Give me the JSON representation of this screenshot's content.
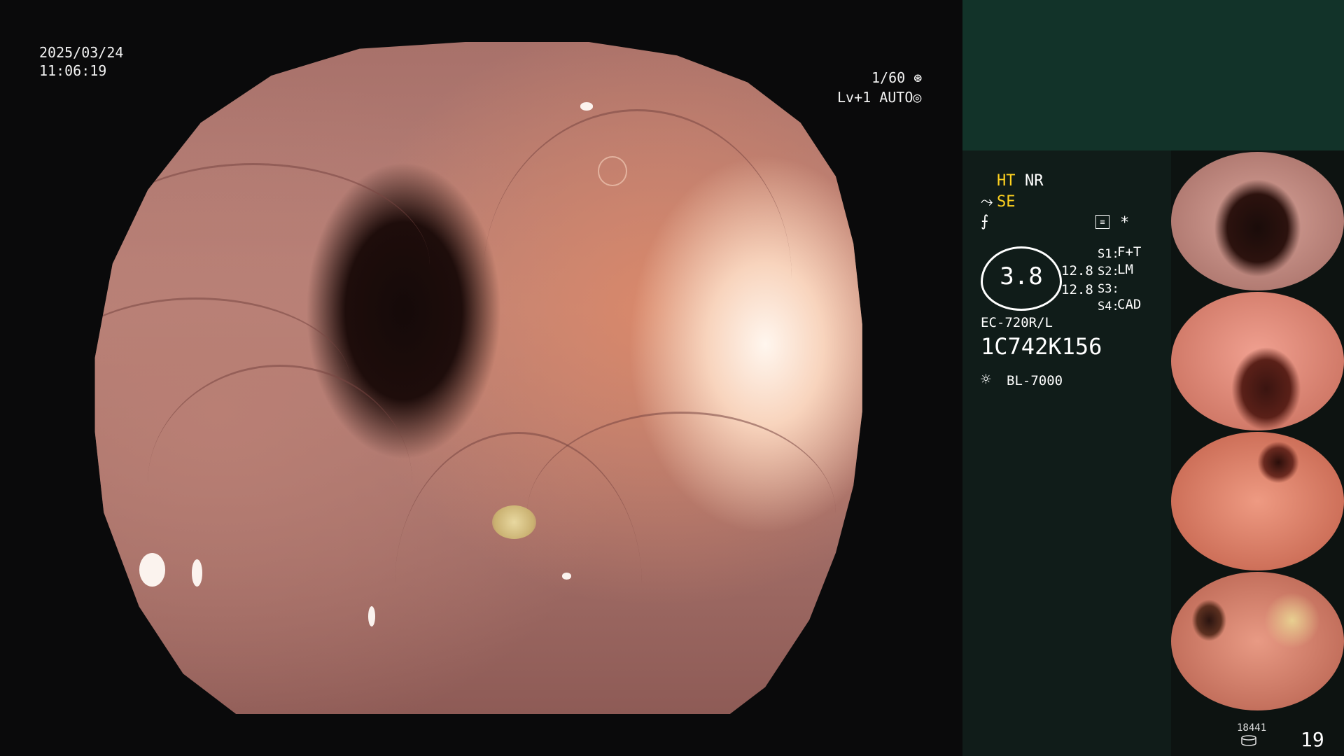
{
  "overlay": {
    "date": "2025/03/24",
    "time": "11:06:19",
    "shutter": "1/60",
    "level": "Lv+1",
    "iris_mode": "AUTO"
  },
  "settings": {
    "ht": "HT",
    "nr": "NR",
    "se": "SE",
    "gauge_value": "3.8",
    "value_a": "12.8",
    "value_b": "12.8",
    "s1_key": "S1:",
    "s1_val": "F+T",
    "s2_key": "S2:",
    "s2_val": "LM",
    "s3_key": "S3:",
    "s3_val": "",
    "s4_key": "S4:",
    "s4_val": "CAD",
    "scope_model": "EC-720R/L",
    "serial": "1C742K156",
    "light_source": "BL-7000"
  },
  "counter": {
    "images": "18441",
    "number": "19"
  },
  "colors": {
    "accent_yellow": "#ffd21f",
    "panel_bg": "#101c19",
    "panel_top": "#123329"
  }
}
